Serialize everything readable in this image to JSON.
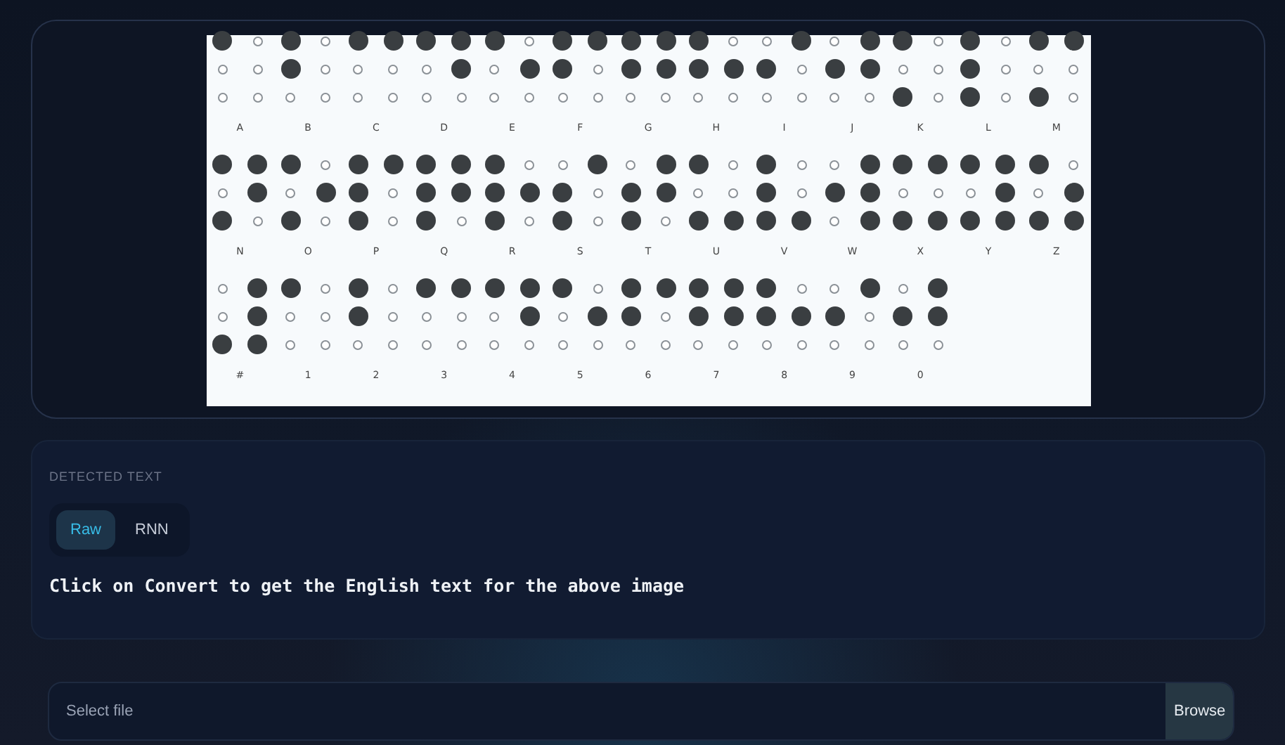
{
  "image": {
    "cells": [
      {
        "label": "A",
        "dots": [
          true,
          false,
          false,
          false,
          false,
          false
        ]
      },
      {
        "label": "B",
        "dots": [
          true,
          false,
          true,
          false,
          false,
          false
        ]
      },
      {
        "label": "C",
        "dots": [
          true,
          true,
          false,
          false,
          false,
          false
        ]
      },
      {
        "label": "D",
        "dots": [
          true,
          true,
          false,
          true,
          false,
          false
        ]
      },
      {
        "label": "E",
        "dots": [
          true,
          false,
          false,
          true,
          false,
          false
        ]
      },
      {
        "label": "F",
        "dots": [
          true,
          true,
          true,
          false,
          false,
          false
        ]
      },
      {
        "label": "G",
        "dots": [
          true,
          true,
          true,
          true,
          false,
          false
        ]
      },
      {
        "label": "H",
        "dots": [
          true,
          false,
          true,
          true,
          false,
          false
        ]
      },
      {
        "label": "I",
        "dots": [
          false,
          true,
          true,
          false,
          false,
          false
        ]
      },
      {
        "label": "J",
        "dots": [
          false,
          true,
          true,
          true,
          false,
          false
        ]
      },
      {
        "label": "K",
        "dots": [
          true,
          false,
          false,
          false,
          true,
          false
        ]
      },
      {
        "label": "L",
        "dots": [
          true,
          false,
          true,
          false,
          true,
          false
        ]
      },
      {
        "label": "M",
        "dots": [
          true,
          true,
          false,
          false,
          true,
          false
        ]
      },
      {
        "label": "N",
        "dots": [
          true,
          true,
          false,
          true,
          true,
          false
        ]
      },
      {
        "label": "O",
        "dots": [
          true,
          false,
          false,
          true,
          true,
          false
        ]
      },
      {
        "label": "P",
        "dots": [
          true,
          true,
          true,
          false,
          true,
          false
        ]
      },
      {
        "label": "Q",
        "dots": [
          true,
          true,
          true,
          true,
          true,
          false
        ]
      },
      {
        "label": "R",
        "dots": [
          true,
          false,
          true,
          true,
          true,
          false
        ]
      },
      {
        "label": "S",
        "dots": [
          false,
          true,
          true,
          false,
          true,
          false
        ]
      },
      {
        "label": "T",
        "dots": [
          false,
          true,
          true,
          true,
          true,
          false
        ]
      },
      {
        "label": "U",
        "dots": [
          true,
          false,
          false,
          false,
          true,
          true
        ]
      },
      {
        "label": "V",
        "dots": [
          true,
          false,
          true,
          false,
          true,
          true
        ]
      },
      {
        "label": "W",
        "dots": [
          false,
          true,
          true,
          true,
          false,
          true
        ]
      },
      {
        "label": "X",
        "dots": [
          true,
          true,
          false,
          false,
          true,
          true
        ]
      },
      {
        "label": "Y",
        "dots": [
          true,
          true,
          false,
          true,
          true,
          true
        ]
      },
      {
        "label": "Z",
        "dots": [
          true,
          false,
          false,
          true,
          true,
          true
        ]
      },
      {
        "label": "#",
        "dots": [
          false,
          true,
          false,
          true,
          true,
          true
        ]
      },
      {
        "label": "1",
        "dots": [
          true,
          false,
          false,
          false,
          false,
          false
        ]
      },
      {
        "label": "2",
        "dots": [
          true,
          false,
          true,
          false,
          false,
          false
        ]
      },
      {
        "label": "3",
        "dots": [
          true,
          true,
          false,
          false,
          false,
          false
        ]
      },
      {
        "label": "4",
        "dots": [
          true,
          true,
          false,
          true,
          false,
          false
        ]
      },
      {
        "label": "5",
        "dots": [
          true,
          false,
          false,
          true,
          false,
          false
        ]
      },
      {
        "label": "6",
        "dots": [
          true,
          true,
          true,
          false,
          false,
          false
        ]
      },
      {
        "label": "7",
        "dots": [
          true,
          true,
          true,
          true,
          false,
          false
        ]
      },
      {
        "label": "8",
        "dots": [
          true,
          false,
          true,
          true,
          false,
          false
        ]
      },
      {
        "label": "9",
        "dots": [
          false,
          true,
          true,
          false,
          false,
          false
        ]
      },
      {
        "label": "0",
        "dots": [
          false,
          true,
          true,
          true,
          false,
          false
        ]
      }
    ]
  },
  "detected": {
    "heading": "DETECTED TEXT",
    "modes": [
      {
        "label": "Raw",
        "selected": true
      },
      {
        "label": "RNN",
        "selected": false
      }
    ],
    "message": "Click on Convert to get the English text for the above image"
  },
  "file_input": {
    "placeholder": "Select file",
    "button": "Browse"
  }
}
